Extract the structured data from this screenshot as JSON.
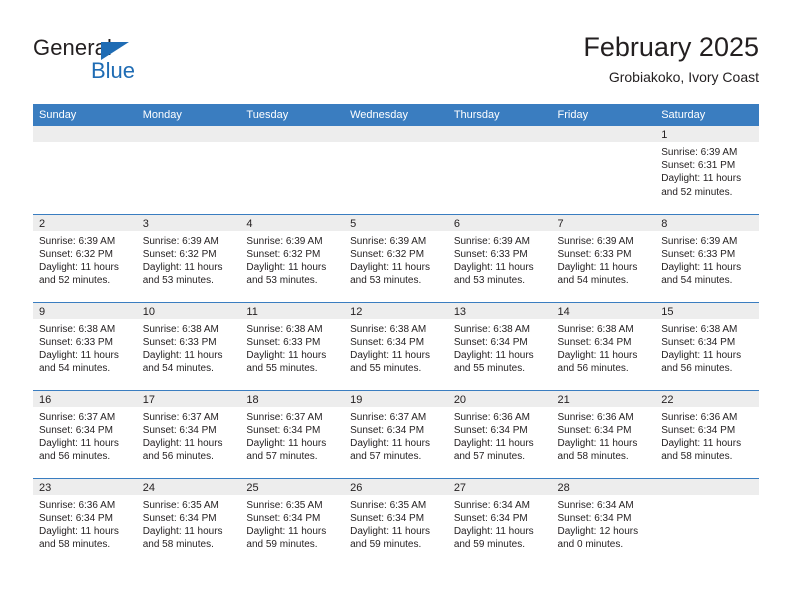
{
  "brand": {
    "name_part1": "General",
    "name_part2": "Blue",
    "accent_color": "#1f6cb4"
  },
  "header": {
    "title": "February 2025",
    "subtitle": "Grobiakoko, Ivory Coast"
  },
  "theme": {
    "header_bg": "#3a7dc0",
    "daynum_band_bg": "#ededed",
    "row_divider": "#3a7dc0",
    "text": "#231f20"
  },
  "weekday_headers": [
    "Sunday",
    "Monday",
    "Tuesday",
    "Wednesday",
    "Thursday",
    "Friday",
    "Saturday"
  ],
  "labels": {
    "sunrise_prefix": "Sunrise:",
    "sunset_prefix": "Sunset:",
    "daylight_prefix": "Daylight:"
  },
  "weeks": [
    [
      {
        "day": "",
        "empty": true
      },
      {
        "day": "",
        "empty": true
      },
      {
        "day": "",
        "empty": true
      },
      {
        "day": "",
        "empty": true
      },
      {
        "day": "",
        "empty": true
      },
      {
        "day": "",
        "empty": true
      },
      {
        "day": "1",
        "sunrise": "Sunrise: 6:39 AM",
        "sunset": "Sunset: 6:31 PM",
        "daylight": "Daylight: 11 hours and 52 minutes."
      }
    ],
    [
      {
        "day": "2",
        "sunrise": "Sunrise: 6:39 AM",
        "sunset": "Sunset: 6:32 PM",
        "daylight": "Daylight: 11 hours and 52 minutes."
      },
      {
        "day": "3",
        "sunrise": "Sunrise: 6:39 AM",
        "sunset": "Sunset: 6:32 PM",
        "daylight": "Daylight: 11 hours and 53 minutes."
      },
      {
        "day": "4",
        "sunrise": "Sunrise: 6:39 AM",
        "sunset": "Sunset: 6:32 PM",
        "daylight": "Daylight: 11 hours and 53 minutes."
      },
      {
        "day": "5",
        "sunrise": "Sunrise: 6:39 AM",
        "sunset": "Sunset: 6:32 PM",
        "daylight": "Daylight: 11 hours and 53 minutes."
      },
      {
        "day": "6",
        "sunrise": "Sunrise: 6:39 AM",
        "sunset": "Sunset: 6:33 PM",
        "daylight": "Daylight: 11 hours and 53 minutes."
      },
      {
        "day": "7",
        "sunrise": "Sunrise: 6:39 AM",
        "sunset": "Sunset: 6:33 PM",
        "daylight": "Daylight: 11 hours and 54 minutes."
      },
      {
        "day": "8",
        "sunrise": "Sunrise: 6:39 AM",
        "sunset": "Sunset: 6:33 PM",
        "daylight": "Daylight: 11 hours and 54 minutes."
      }
    ],
    [
      {
        "day": "9",
        "sunrise": "Sunrise: 6:38 AM",
        "sunset": "Sunset: 6:33 PM",
        "daylight": "Daylight: 11 hours and 54 minutes."
      },
      {
        "day": "10",
        "sunrise": "Sunrise: 6:38 AM",
        "sunset": "Sunset: 6:33 PM",
        "daylight": "Daylight: 11 hours and 54 minutes."
      },
      {
        "day": "11",
        "sunrise": "Sunrise: 6:38 AM",
        "sunset": "Sunset: 6:33 PM",
        "daylight": "Daylight: 11 hours and 55 minutes."
      },
      {
        "day": "12",
        "sunrise": "Sunrise: 6:38 AM",
        "sunset": "Sunset: 6:34 PM",
        "daylight": "Daylight: 11 hours and 55 minutes."
      },
      {
        "day": "13",
        "sunrise": "Sunrise: 6:38 AM",
        "sunset": "Sunset: 6:34 PM",
        "daylight": "Daylight: 11 hours and 55 minutes."
      },
      {
        "day": "14",
        "sunrise": "Sunrise: 6:38 AM",
        "sunset": "Sunset: 6:34 PM",
        "daylight": "Daylight: 11 hours and 56 minutes."
      },
      {
        "day": "15",
        "sunrise": "Sunrise: 6:38 AM",
        "sunset": "Sunset: 6:34 PM",
        "daylight": "Daylight: 11 hours and 56 minutes."
      }
    ],
    [
      {
        "day": "16",
        "sunrise": "Sunrise: 6:37 AM",
        "sunset": "Sunset: 6:34 PM",
        "daylight": "Daylight: 11 hours and 56 minutes."
      },
      {
        "day": "17",
        "sunrise": "Sunrise: 6:37 AM",
        "sunset": "Sunset: 6:34 PM",
        "daylight": "Daylight: 11 hours and 56 minutes."
      },
      {
        "day": "18",
        "sunrise": "Sunrise: 6:37 AM",
        "sunset": "Sunset: 6:34 PM",
        "daylight": "Daylight: 11 hours and 57 minutes."
      },
      {
        "day": "19",
        "sunrise": "Sunrise: 6:37 AM",
        "sunset": "Sunset: 6:34 PM",
        "daylight": "Daylight: 11 hours and 57 minutes."
      },
      {
        "day": "20",
        "sunrise": "Sunrise: 6:36 AM",
        "sunset": "Sunset: 6:34 PM",
        "daylight": "Daylight: 11 hours and 57 minutes."
      },
      {
        "day": "21",
        "sunrise": "Sunrise: 6:36 AM",
        "sunset": "Sunset: 6:34 PM",
        "daylight": "Daylight: 11 hours and 58 minutes."
      },
      {
        "day": "22",
        "sunrise": "Sunrise: 6:36 AM",
        "sunset": "Sunset: 6:34 PM",
        "daylight": "Daylight: 11 hours and 58 minutes."
      }
    ],
    [
      {
        "day": "23",
        "sunrise": "Sunrise: 6:36 AM",
        "sunset": "Sunset: 6:34 PM",
        "daylight": "Daylight: 11 hours and 58 minutes."
      },
      {
        "day": "24",
        "sunrise": "Sunrise: 6:35 AM",
        "sunset": "Sunset: 6:34 PM",
        "daylight": "Daylight: 11 hours and 58 minutes."
      },
      {
        "day": "25",
        "sunrise": "Sunrise: 6:35 AM",
        "sunset": "Sunset: 6:34 PM",
        "daylight": "Daylight: 11 hours and 59 minutes."
      },
      {
        "day": "26",
        "sunrise": "Sunrise: 6:35 AM",
        "sunset": "Sunset: 6:34 PM",
        "daylight": "Daylight: 11 hours and 59 minutes."
      },
      {
        "day": "27",
        "sunrise": "Sunrise: 6:34 AM",
        "sunset": "Sunset: 6:34 PM",
        "daylight": "Daylight: 11 hours and 59 minutes."
      },
      {
        "day": "28",
        "sunrise": "Sunrise: 6:34 AM",
        "sunset": "Sunset: 6:34 PM",
        "daylight": "Daylight: 12 hours and 0 minutes."
      },
      {
        "day": "",
        "empty": true
      }
    ]
  ]
}
